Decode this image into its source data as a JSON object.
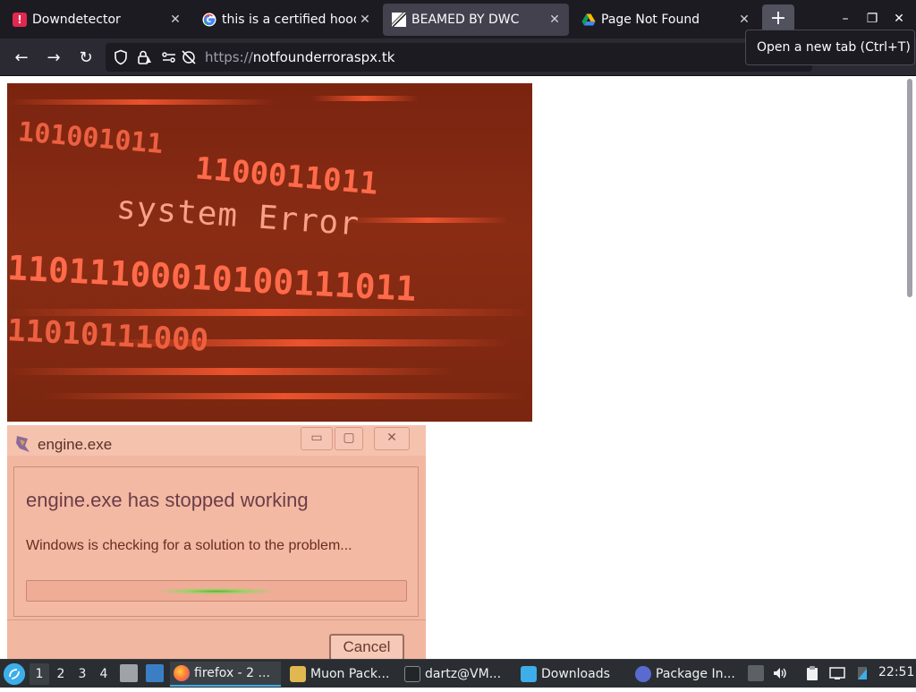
{
  "tabs": [
    {
      "title": "Downdetector",
      "icon": "exclamation-icon",
      "active": false
    },
    {
      "title": "this is a certified hood",
      "icon": "google-icon",
      "active": false
    },
    {
      "title": "BEAMED BY DWC",
      "icon": "beamed-icon",
      "active": true
    },
    {
      "title": "Page Not Found",
      "icon": "google-drive-icon",
      "active": false
    }
  ],
  "tab_close_glyph": "✕",
  "new_tab_glyph": "+",
  "tooltip": "Open a new tab (Ctrl+T)",
  "window_controls": {
    "minimize": "–",
    "restore": "❐",
    "close": "✕"
  },
  "nav": {
    "back": "←",
    "forward": "→",
    "reload": "↻"
  },
  "url": {
    "protocol": "https://",
    "host": "notfounderroraspx.tk"
  },
  "content": {
    "image1": {
      "caption": "system Error",
      "binary_rows": [
        "101001011",
        "1100011011",
        "11011100010100111011",
        "11010111000"
      ]
    },
    "image2": {
      "window_title": "engine.exe",
      "heading": "engine.exe has stopped working",
      "message": "Windows is checking for a solution to the problem...",
      "cancel_label": "Cancel",
      "progress": 0.5
    }
  },
  "taskbar": {
    "desktops": [
      "1",
      "2",
      "3",
      "4"
    ],
    "active_desktop": "1",
    "tasks": [
      {
        "label": "firefox - 2 ...",
        "icon": "firefox-icon",
        "active": true
      },
      {
        "label": "Muon Pack...",
        "icon": "muon-icon",
        "active": false
      },
      {
        "label": "dartz@VM...",
        "icon": "terminal-icon",
        "active": false
      },
      {
        "label": "Downloads",
        "icon": "folder-icon",
        "active": false
      },
      {
        "label": "Package In...",
        "icon": "package-icon",
        "active": false
      }
    ],
    "clock": "22:51"
  },
  "colors": {
    "tabbar_bg": "#1c1b22",
    "navbar_bg": "#2b2a33",
    "taskbar_bg": "#2a2e32",
    "accent": "#3daee9"
  }
}
